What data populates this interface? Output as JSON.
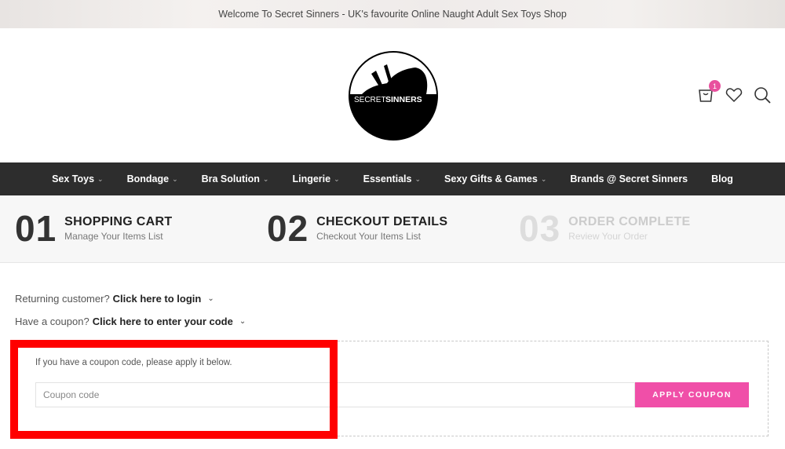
{
  "topbar": {
    "text": "Welcome To Secret Sinners - UK's favourite Online Naught Adult Sex Toys Shop"
  },
  "logo": {
    "word1": "SECRET",
    "word2": "SINNERS"
  },
  "header_icons": {
    "cart_count": "1",
    "cart_icon": "cart-icon",
    "wishlist_icon": "heart-icon",
    "search_icon": "search-icon"
  },
  "nav": {
    "items": [
      {
        "label": "Sex Toys",
        "has_dropdown": true
      },
      {
        "label": "Bondage",
        "has_dropdown": true
      },
      {
        "label": "Bra Solution",
        "has_dropdown": true
      },
      {
        "label": "Lingerie",
        "has_dropdown": true
      },
      {
        "label": "Essentials",
        "has_dropdown": true
      },
      {
        "label": "Sexy Gifts & Games",
        "has_dropdown": true
      },
      {
        "label": "Brands @ Secret Sinners",
        "has_dropdown": false
      },
      {
        "label": "Blog",
        "has_dropdown": false
      }
    ]
  },
  "steps": [
    {
      "num": "01",
      "title": "SHOPPING CART",
      "sub": "Manage Your Items List",
      "active": true
    },
    {
      "num": "02",
      "title": "CHECKOUT DETAILS",
      "sub": "Checkout Your Items List",
      "active": true
    },
    {
      "num": "03",
      "title": "ORDER COMPLETE",
      "sub": "Review Your Order",
      "active": false
    }
  ],
  "login_notice": {
    "prefix": "Returning customer?",
    "link": "Click here to login"
  },
  "coupon_notice": {
    "prefix": "Have a coupon?",
    "link": "Click here to enter your code"
  },
  "coupon": {
    "hint": "If you have a coupon code, please apply it below.",
    "placeholder": "Coupon code",
    "button_label": "APPLY COUPON"
  },
  "colors": {
    "accent": "#f04fa8",
    "nav_bg": "#2d2d2d",
    "highlight": "#ff0000"
  }
}
